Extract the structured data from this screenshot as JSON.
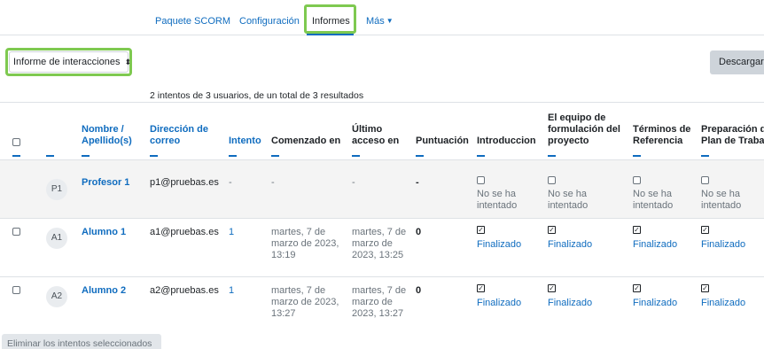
{
  "tabs": [
    {
      "label": "Paquete SCORM"
    },
    {
      "label": "Configuración"
    },
    {
      "label": "Informes"
    },
    {
      "label": "Más"
    }
  ],
  "report_select": {
    "value": "Informe de interacciones"
  },
  "download_button": {
    "label": "Descargar"
  },
  "summary": "2 intentos de 3 usuarios, de un total de 3 resultados",
  "columns": {
    "name": [
      "Nombre /",
      "Apellido(s)"
    ],
    "email": [
      "Dirección de",
      "correo"
    ],
    "attempt": "Intento",
    "started": "Comenzado en",
    "last_access": [
      "Último",
      "acceso en"
    ],
    "score": "Puntuación",
    "q1": "Introduccion",
    "q2": [
      "El equipo de",
      "formulación del",
      "proyecto"
    ],
    "q3": [
      "Términos de",
      "Referencia"
    ],
    "q4": [
      "Preparación de",
      "Plan de Trabajo"
    ]
  },
  "rows": [
    {
      "initials": "P1",
      "name": "Profesor 1",
      "email": "p1@pruebas.es",
      "attempt": "-",
      "started": "-",
      "last_access": "-",
      "score": "-",
      "status_lines": [
        "No se ha",
        "intentado"
      ]
    },
    {
      "initials": "A1",
      "name": "Alumno 1",
      "email": "a1@pruebas.es",
      "attempt": "1",
      "started": [
        "martes, 7 de",
        "marzo de 2023,",
        "13:19"
      ],
      "last_access": [
        "martes, 7 de",
        "marzo de",
        "2023, 13:25"
      ],
      "score": "0",
      "status": "Finalizado"
    },
    {
      "initials": "A2",
      "name": "Alumno 2",
      "email": "a2@pruebas.es",
      "attempt": "1",
      "started": [
        "martes, 7 de",
        "marzo de 2023,",
        "13:27"
      ],
      "last_access": [
        "martes, 7 de",
        "marzo de",
        "2023, 13:27"
      ],
      "score": "0",
      "status": "Finalizado"
    }
  ],
  "delete_button": {
    "label": "Eliminar los intentos seleccionados"
  },
  "colors": {
    "accent": "#0f6cbf",
    "highlight": "#7ec950",
    "row_shade": "#f4f4f4"
  }
}
